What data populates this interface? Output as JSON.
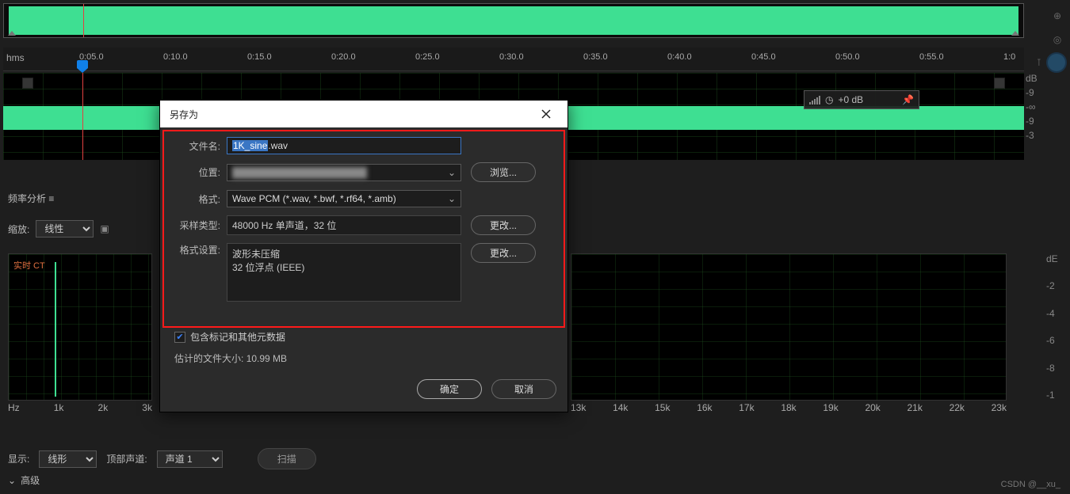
{
  "ruler": {
    "hms_label": "hms",
    "ticks": [
      "0:05.0",
      "0:10.0",
      "0:15.0",
      "0:20.0",
      "0:25.0",
      "0:30.0",
      "0:35.0",
      "0:40.0",
      "0:45.0",
      "0:50.0",
      "0:55.0",
      "1:0"
    ]
  },
  "main_db": [
    "dB",
    "-9",
    "-∞",
    "-9",
    "-3"
  ],
  "hud": {
    "gain": "+0 dB"
  },
  "freq_panel": {
    "title": "频率分析  ≡",
    "zoom_label": "缩放:",
    "zoom_value": "线性",
    "live_label": "实时 CT",
    "axis_left": [
      "Hz",
      "1k",
      "2k",
      "3k"
    ],
    "axis_right": [
      "13k",
      "14k",
      "15k",
      "16k",
      "17k",
      "18k",
      "19k",
      "20k",
      "21k",
      "22k",
      "23k"
    ],
    "right_db": [
      "dE",
      "-2",
      "-4",
      "-6",
      "-8",
      "-1"
    ]
  },
  "bottom": {
    "display_label": "显示:",
    "display_value": "线形",
    "top_channel_label": "顶部声道:",
    "top_channel_value": "声道 1",
    "scan_label": "扫描",
    "advanced_label": "高级"
  },
  "dialog": {
    "title": "另存为",
    "filename_label": "文件名:",
    "filename_selected": "1K_sine",
    "filename_ext": ".wav",
    "location_label": "位置:",
    "location_value": "████████████████████",
    "browse_label": "浏览...",
    "format_label": "格式:",
    "format_value": "Wave PCM (*.wav, *.bwf, *.rf64, *.amb)",
    "sample_type_label": "采样类型:",
    "sample_type_value": "48000 Hz 单声道，32 位",
    "change_label": "更改...",
    "format_settings_label": "格式设置:",
    "format_settings_line1": "波形未压缩",
    "format_settings_line2": "32 位浮点 (IEEE)",
    "include_meta_label": "包含标记和其他元数据",
    "estimate_label": "估计的文件大小:",
    "estimate_value": "10.99 MB",
    "ok_label": "确定",
    "cancel_label": "取消"
  },
  "watermark": "CSDN @__xu_"
}
